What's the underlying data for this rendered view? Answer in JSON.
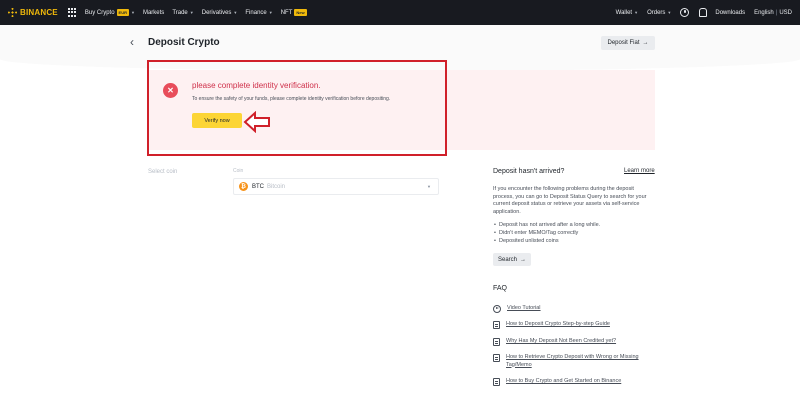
{
  "nav": {
    "brand": "BINANCE",
    "items": [
      {
        "label": "Buy Crypto",
        "badge": "EUR",
        "caret": true
      },
      {
        "label": "Markets",
        "badge": null,
        "caret": false
      },
      {
        "label": "Trade",
        "badge": null,
        "caret": true
      },
      {
        "label": "Derivatives",
        "badge": null,
        "caret": true
      },
      {
        "label": "Finance",
        "badge": null,
        "caret": true
      },
      {
        "label": "NFT",
        "badge": "New",
        "caret": false
      }
    ],
    "right": {
      "wallet": "Wallet",
      "orders": "Orders",
      "downloads": "Downloads",
      "language": "English",
      "currency": "USD"
    }
  },
  "header": {
    "title": "Deposit Crypto",
    "deposit_fiat": "Deposit Fiat"
  },
  "alert": {
    "title": "please complete identity verification.",
    "description": "To ensure the safety of your funds, please complete identity verification before depositing.",
    "verify_button": "Verify now"
  },
  "form": {
    "select_coin": "Select coin",
    "coin_label": "Coin",
    "coin_symbol": "BTC",
    "coin_name": "Bitcoin"
  },
  "side": {
    "title": "Deposit hasn't arrived?",
    "learn_more": "Learn more",
    "body": "If you encounter the following problems during the deposit process, you can go to Deposit Status Query to search for your current deposit status or retrieve your assets via self-service application.",
    "list": [
      "Deposit has not arrived after a long while.",
      "Didn't enter MEMO/Tag correctly",
      "Deposited unlisted coins"
    ],
    "search_button": "Search"
  },
  "faq": {
    "title": "FAQ",
    "items": [
      "Video Tutorial",
      "How to Deposit Crypto Step-by-step Guide",
      "Why Has My Deposit Not Been Credited yet?",
      "How to Retrieve Crypto Deposit with Wrong or Missing Tag/Memo",
      "How to Buy Crypto and Get Started on Binance"
    ]
  },
  "colors": {
    "brand": "#f0b90b",
    "topbar": "#181a20",
    "alert_bg": "#fef1f2",
    "alert_red": "#cf304a",
    "verify_yellow": "#fcd535",
    "annotation_red": "#d0202a"
  }
}
